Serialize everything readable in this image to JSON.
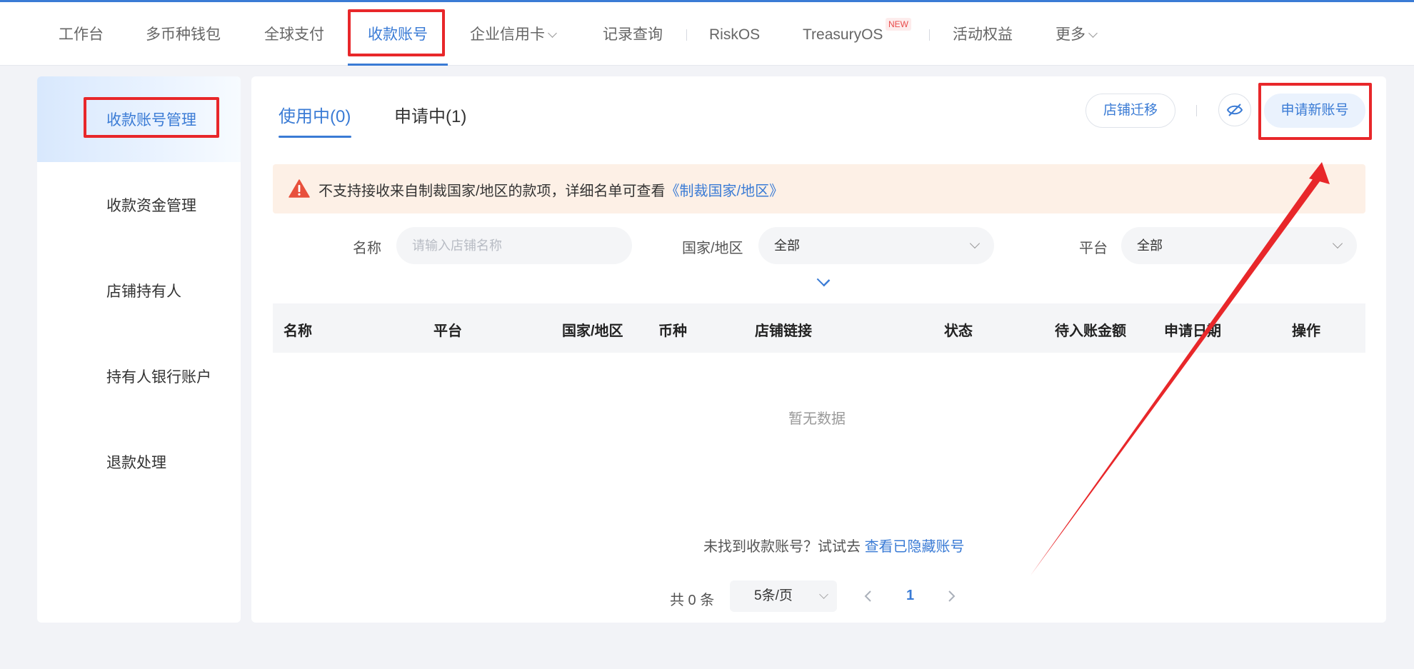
{
  "nav": {
    "items": [
      {
        "label": "工作台"
      },
      {
        "label": "多币种钱包"
      },
      {
        "label": "全球支付"
      },
      {
        "label": "收款账号"
      },
      {
        "label": "企业信用卡"
      },
      {
        "label": "记录查询"
      },
      {
        "label": "RiskOS"
      },
      {
        "label": "TreasuryOS"
      },
      {
        "label": "活动权益"
      },
      {
        "label": "更多"
      }
    ],
    "new_badge": "NEW",
    "active_index": 3
  },
  "sidebar": {
    "items": [
      {
        "label": "收款账号管理"
      },
      {
        "label": "收款资金管理"
      },
      {
        "label": "店铺持有人"
      },
      {
        "label": "持有人银行账户"
      },
      {
        "label": "退款处理"
      }
    ],
    "active_index": 0
  },
  "tabs": [
    {
      "label": "使用中(0)"
    },
    {
      "label": "申请中(1)"
    }
  ],
  "actions": {
    "migrate": "店铺迁移",
    "apply_new": "申请新账号",
    "hide_icon": "eye-off-icon"
  },
  "alert": {
    "text": "不支持接收来自制裁国家/地区的款项，详细名单可查看",
    "link": "《制裁国家/地区》",
    "icon": "warning-icon"
  },
  "filters": {
    "name_label": "名称",
    "name_placeholder": "请输入店铺名称",
    "country_label": "国家/地区",
    "country_value": "全部",
    "platform_label": "平台",
    "platform_value": "全部"
  },
  "table": {
    "columns": [
      "名称",
      "平台",
      "国家/地区",
      "币种",
      "店铺链接",
      "状态",
      "待入账金额",
      "申请日期",
      "操作"
    ],
    "empty_text": "暂无数据"
  },
  "hint": {
    "text": "未找到收款账号？试试去",
    "link": "查看已隐藏账号"
  },
  "pagination": {
    "total": "共 0 条",
    "page_size": "5条/页",
    "current_page": "1"
  },
  "colors": {
    "accent": "#3a7bd5",
    "annotation": "#e8272a",
    "alert_bg": "#fdf0e6"
  }
}
